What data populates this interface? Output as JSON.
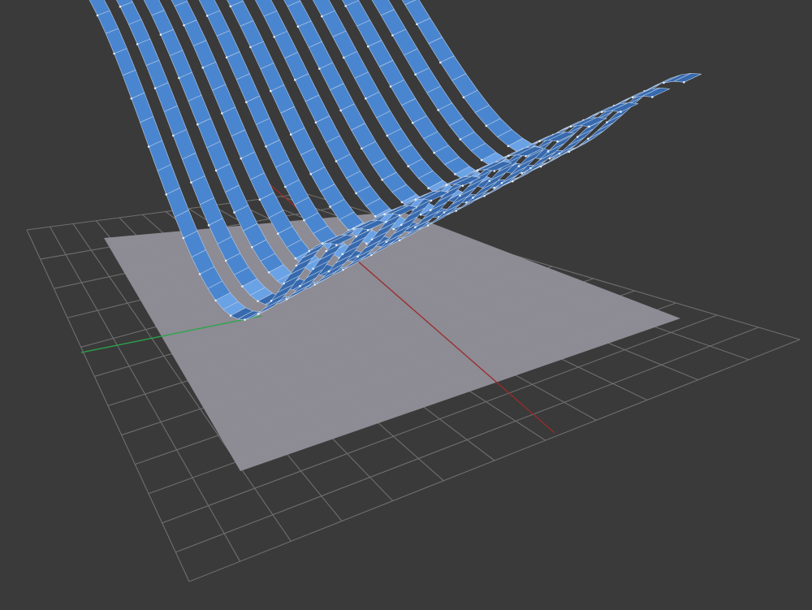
{
  "viewport": {
    "background": "#3a3a3a",
    "projection": "perspective"
  },
  "grid": {
    "divisions": 12,
    "line_color": "#6e6e6e",
    "x_axis_color": "#9a2b2b",
    "y_axis_color": "#2aa54a"
  },
  "ground_plane": {
    "color": "#8f8d96"
  },
  "surface": {
    "shape": "sine-wave-tile-array",
    "rows": 12,
    "tiles_per_row": 34,
    "amplitude": 1.0,
    "wave_cycles": 1,
    "tile_color": "#4a86d0",
    "tile_highlight": "#6aa2e6",
    "tile_shadow": "#3769ad",
    "edge_color": "#b9cbe3",
    "vertex_color": "#e6eef8"
  }
}
